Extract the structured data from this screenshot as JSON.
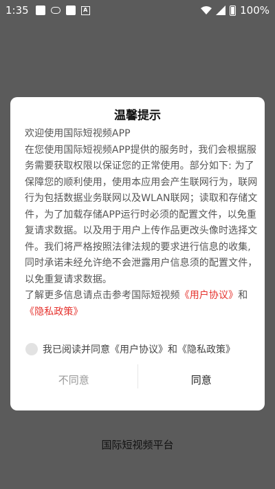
{
  "status_bar": {
    "time": "1:35",
    "battery_text": "100%"
  },
  "dialog": {
    "title": "温馨提示",
    "welcome": "欢迎使用国际短视频APP",
    "paragraph1": "在您使用国际短视频APP提供的服务时，我们会根据服务需要获取权限以保证您的正常使用。部分如下: 为了保障您的顺利使用，使用本应用会产生联网行为，联网行为包括数据业务联网以及WLAN联网；读取和存储文件，为了加载存储APP运行时必须的配置文件，以免重复请求数据。以及用于用户上传作品更改头像时选择文件。我们将严格按照法律法规的要求进行信息的收集,同时承诺未经允许绝不会泄露用户信息须的配置文件，以免重复请求数据。",
    "more_info_prefix": "了解更多信息请点击参考国际短视频",
    "user_agreement_link": "《用户协议》",
    "and": "和",
    "privacy_link": "《隐私政策》",
    "agree_checkbox_label": "我已阅读并同意《用户协议》和《隐私政策》",
    "disagree_button": "不同意",
    "agree_button": "同意"
  },
  "footer": {
    "app_name": "国际短视频平台"
  }
}
